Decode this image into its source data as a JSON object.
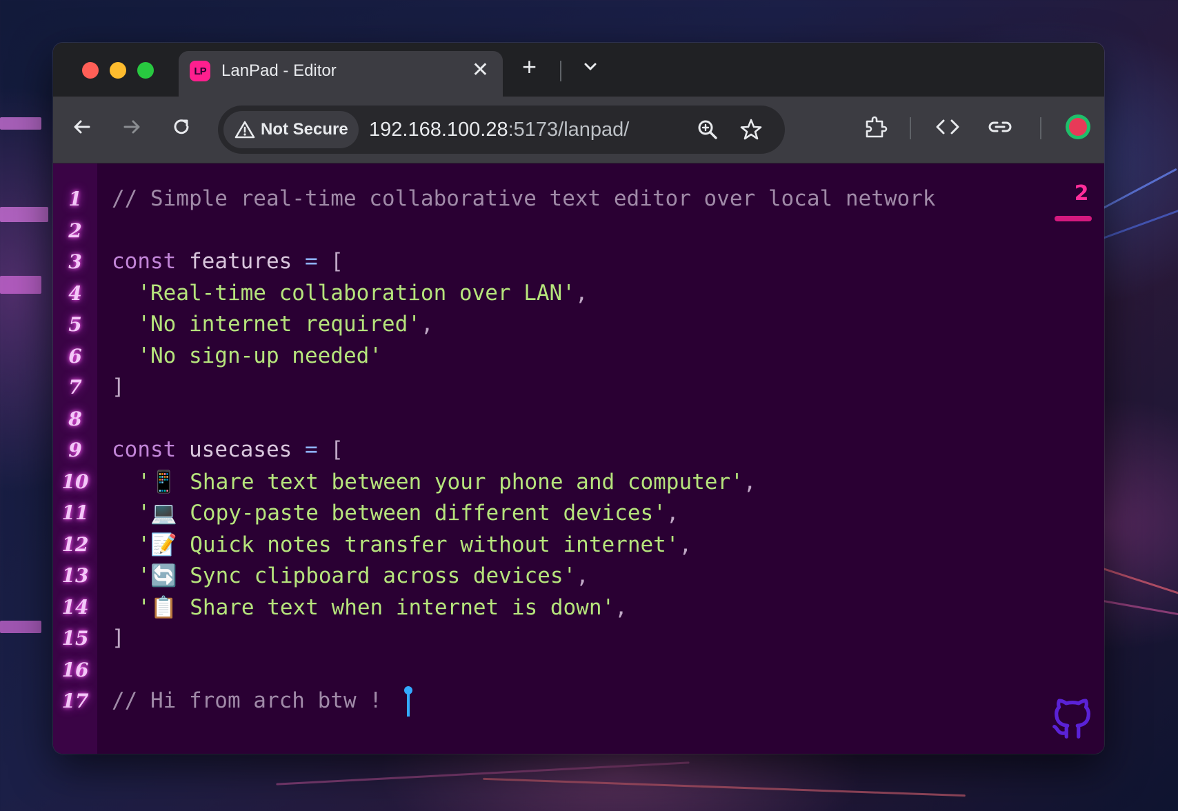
{
  "window": {
    "controls": [
      "close",
      "minimize",
      "zoom"
    ]
  },
  "tab": {
    "icon_text": "LP",
    "title": "LanPad - Editor",
    "close_label": "✕"
  },
  "tabstrip": {
    "new_tab_label": "+",
    "tab_search_label": "⌄"
  },
  "toolbar": {
    "security_label": "Not Secure",
    "url_host": "192.168.100.28",
    "url_path": ":5173/lanpad/"
  },
  "editor": {
    "line_numbers": [
      "1",
      "2",
      "3",
      "4",
      "5",
      "6",
      "7",
      "8",
      "9",
      "10",
      "11",
      "12",
      "13",
      "14",
      "15",
      "16",
      "17"
    ],
    "lines": {
      "l1": "// Simple real-time collaborative text editor over local network",
      "l3_kw": "const",
      "l3_id": " features ",
      "l3_op": "=",
      "l3_brk": " [",
      "l4": "  'Real-time collaboration over LAN'",
      "l4_tail": ",",
      "l5": "  'No internet required'",
      "l5_tail": ",",
      "l6": "  'No sign-up needed'",
      "l7": "]",
      "l9_kw": "const",
      "l9_id": " usecases ",
      "l9_op": "=",
      "l9_brk": " [",
      "l10": "  '📱 Share text between your phone and computer'",
      "l10_tail": ",",
      "l11": "  '💻 Copy-paste between different devices'",
      "l11_tail": ",",
      "l12": "  '📝 Quick notes transfer without internet'",
      "l12_tail": ",",
      "l13": "  '🔄 Sync clipboard across devices'",
      "l13_tail": ",",
      "l14": "  '📋 Share text when internet is down'",
      "l14_tail": ",",
      "l15": "]",
      "l17": "// Hi from arch btw !"
    },
    "connected_users": "2"
  },
  "colors": {
    "editor_bg": "#2a0033",
    "gutter_bg": "#3a0445",
    "string": "#b6e47c",
    "keyword": "#c285d8",
    "accent": "#ff2d9a",
    "cursor": "#33aaff"
  }
}
